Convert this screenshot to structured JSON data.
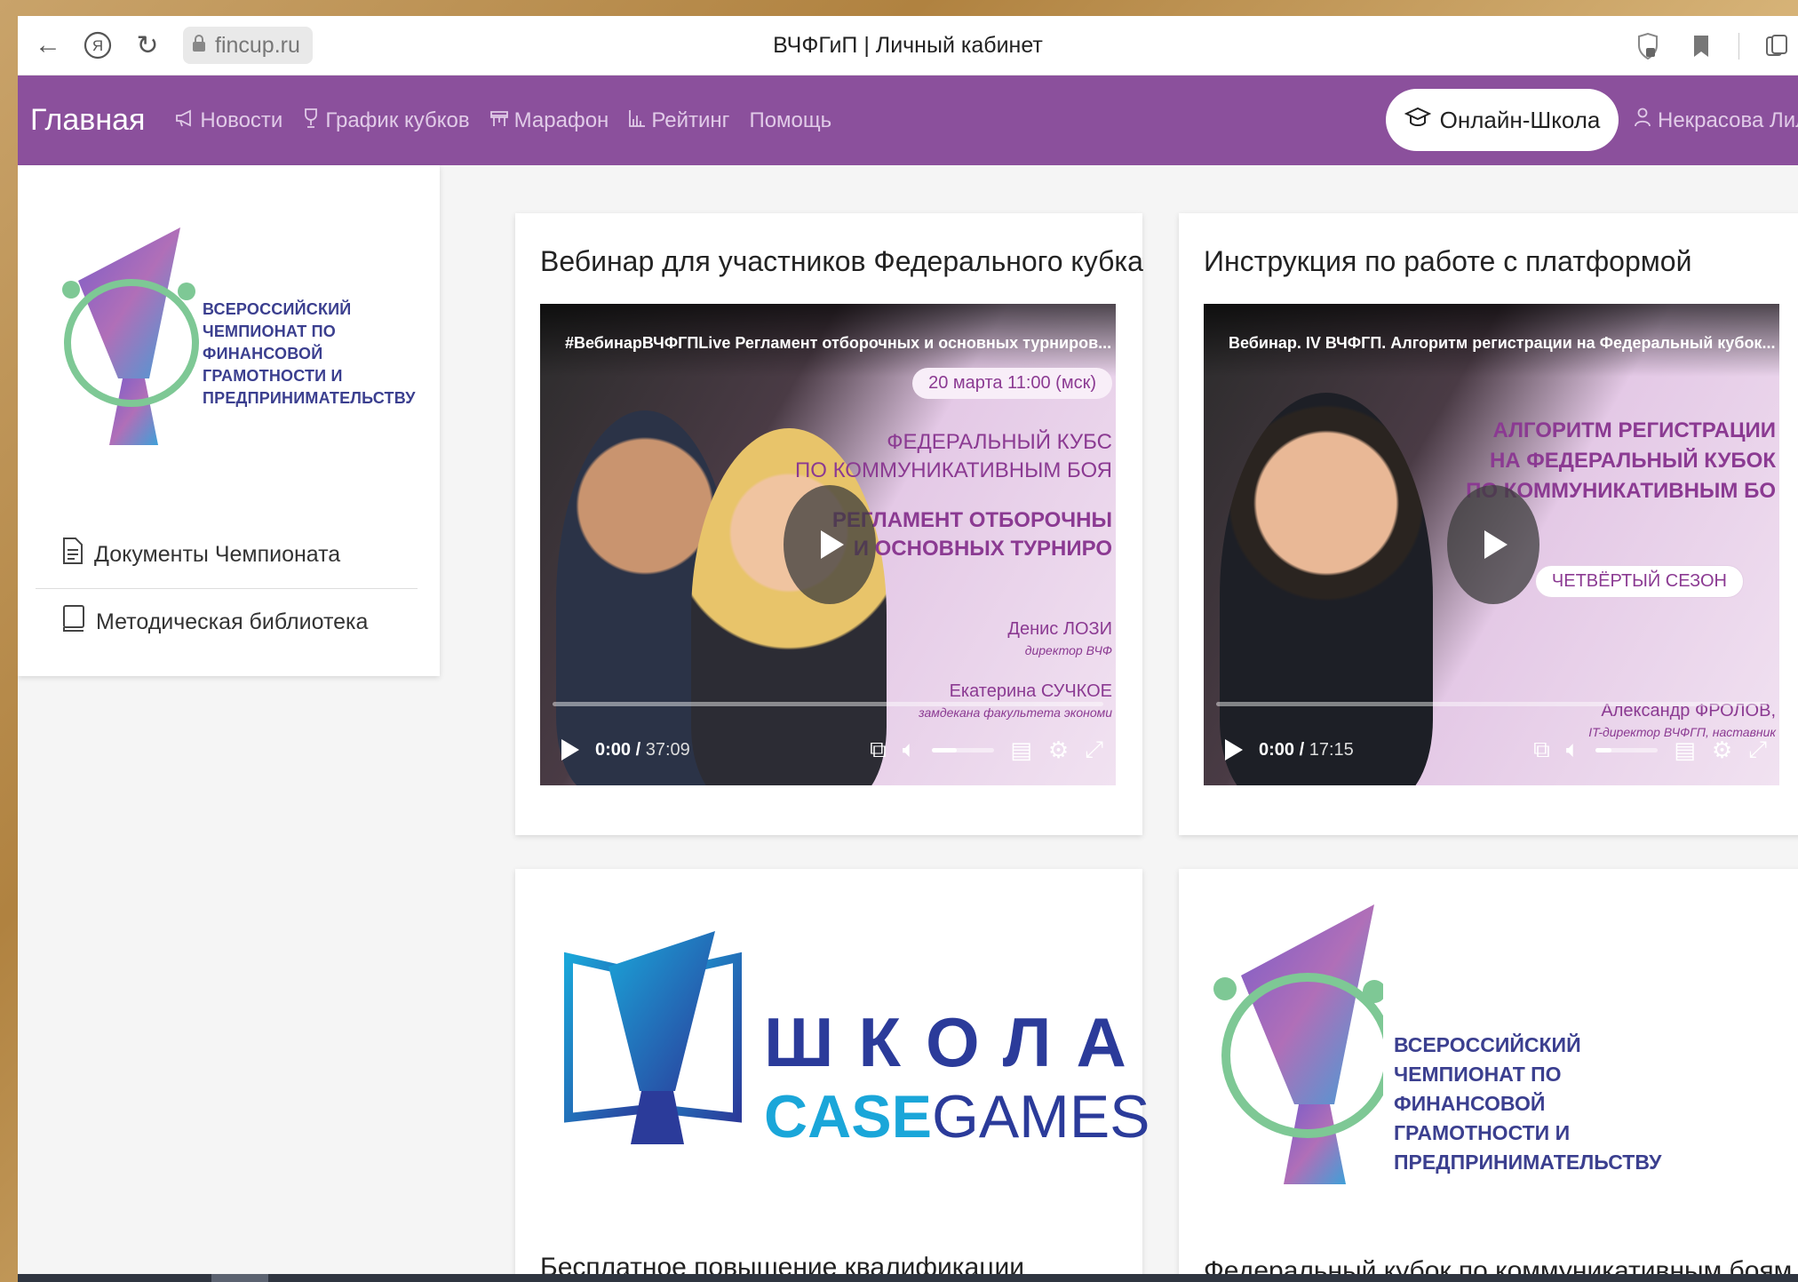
{
  "browser": {
    "url": "fincup.ru",
    "tab_title": "ВЧФГиП | Личный кабинет"
  },
  "nav": {
    "home": "Главная",
    "items": [
      {
        "label": "Новости",
        "icon": "megaphone-icon"
      },
      {
        "label": "График кубков",
        "icon": "trophy-icon"
      },
      {
        "label": "Марафон",
        "icon": "podium-icon"
      },
      {
        "label": "Рейтинг",
        "icon": "bar-chart-icon"
      },
      {
        "label": "Помощь",
        "icon": ""
      }
    ],
    "online_school": "Онлайн-Школа",
    "user": "Некрасова Лилия"
  },
  "sidebar": {
    "logo_text": "ВСЕРОССИЙСКИЙ ЧЕМПИОНАТ ПО ФИНАНСОВОЙ ГРАМОТНОСТИ И ПРЕДПРИНИМАТЕЛЬСТВУ",
    "menu": [
      {
        "label": "Документы Чемпионата",
        "icon": "document-icon"
      },
      {
        "label": "Методическая библиотека",
        "icon": "book-icon"
      }
    ]
  },
  "cards": [
    {
      "title": "Вебинар для участников Федерального кубка",
      "video": {
        "title": "#ВебинарВЧФГПLive Регламент отборочных и основных турниров...",
        "date_pill": "20 марта 11:00 (мск)",
        "line1": "ФЕДЕРАЛЬНЫЙ КУБС",
        "line2": "ПО КОММУНИКАТИВНЫМ БОЯ",
        "line3": "РЕГЛАМЕНТ ОТБОРОЧНЫ",
        "line4": "И ОСНОВНЫХ ТУРНИРО",
        "speaker1": "Денис ЛОЗИ",
        "speaker1_role": "директор ВЧФ",
        "speaker2": "Екатерина СУЧКОЕ",
        "speaker2_role": "замдекана факультета экономи",
        "time_current": "0:00",
        "time_total": "37:09",
        "volume_fraction": 0.4
      }
    },
    {
      "title": "Инструкция по работе с платформой",
      "video": {
        "title": "Вебинар. IV ВЧФГП. Алгоритм регистрации на Федеральный кубок...",
        "line1": "АЛГОРИТМ РЕГИСТРАЦИИ",
        "line2": "НА ФЕДЕРАЛЬНЫЙ КУБОК",
        "line3": "ПО КОММУНИКАТИВНЫМ БО",
        "date_pill": "ЧЕТВЁРТЫЙ СЕЗОН",
        "speaker1": "Александр ФРОЛОВ,",
        "speaker1_role": "IT-директор ВЧФГП, наставник",
        "time_current": "0:00",
        "time_total": "17:15",
        "volume_fraction": 0.25
      }
    },
    {
      "title": "Бесплатное повышение квалификации",
      "logo_word1": "ШКОЛА",
      "logo_word2a": "CASE",
      "logo_word2b": "GAMES"
    },
    {
      "title": "Федеральный кубок по коммуникативным боям",
      "logo_text": "ВСЕРОССИЙСКИЙ ЧЕМПИОНАТ ПО ФИНАНСОВОЙ ГРАМОТНОСТИ И ПРЕДПРИНИМАТЕЛЬСТВУ"
    }
  ],
  "colors": {
    "nav_bg": "#8b509c",
    "logo_text": "#3b3f8f",
    "video_accent": "#8b3a92"
  }
}
